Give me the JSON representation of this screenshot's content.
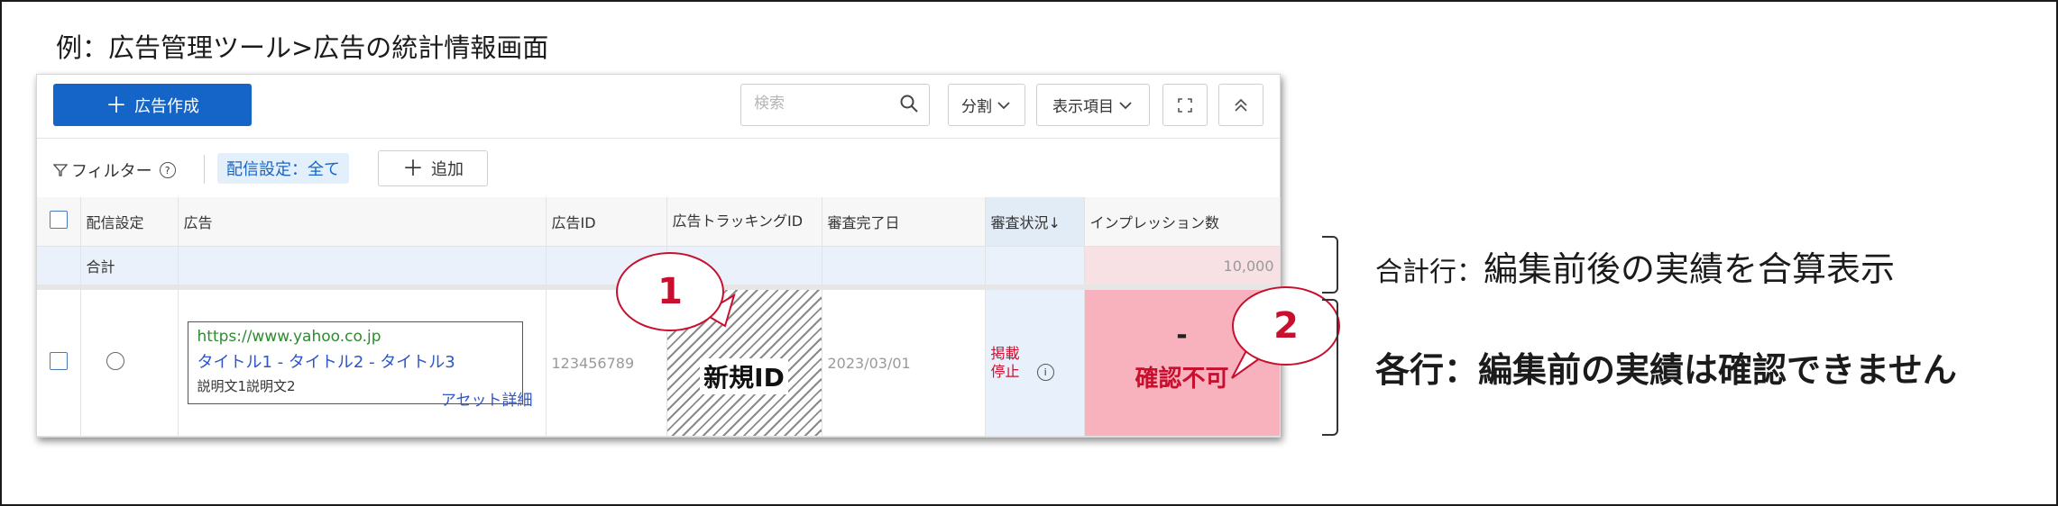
{
  "slide": {
    "title": "例：広告管理ツール>広告の統計情報画面"
  },
  "toolbar": {
    "create_label": "広告作成",
    "search_placeholder": "検索",
    "split_label": "分割",
    "columns_label": "表示項目"
  },
  "filter": {
    "label": "フィルター",
    "chip": "配信設定：全て",
    "add_label": "追加"
  },
  "table": {
    "headers": {
      "delivery": "配信設定",
      "ad": "広告",
      "ad_id": "広告ID",
      "tracking_id": "広告トラッキングID",
      "review_date": "審査完了日",
      "review_status": "審査状況↓",
      "impressions": "インプレッション数"
    },
    "total_row": {
      "label": "合計",
      "impressions": "10,000"
    },
    "row": {
      "ad_url": "https://www.yahoo.co.jp",
      "ad_title": "タイトル1 - タイトル2 - タイトル3",
      "ad_desc": "説明文1説明文2",
      "asset_link": "アセット詳細",
      "ad_id": "123456789",
      "tracking_id": "新規ID",
      "review_date": "2023/03/01",
      "status": "掲載停止",
      "impressions_dash": "-",
      "impressions_text": "確認不可"
    }
  },
  "callouts": {
    "one": "1",
    "two": "2"
  },
  "notes": {
    "total_label": "合計行：",
    "total_text": "編集前後の実績を合算表示",
    "row_label": "各行：",
    "row_text": "編集前の実績は確認できません"
  },
  "colors": {
    "primary": "#1565c8",
    "alert_red": "#c8102e",
    "impression_highlight": "#f8b2be"
  }
}
